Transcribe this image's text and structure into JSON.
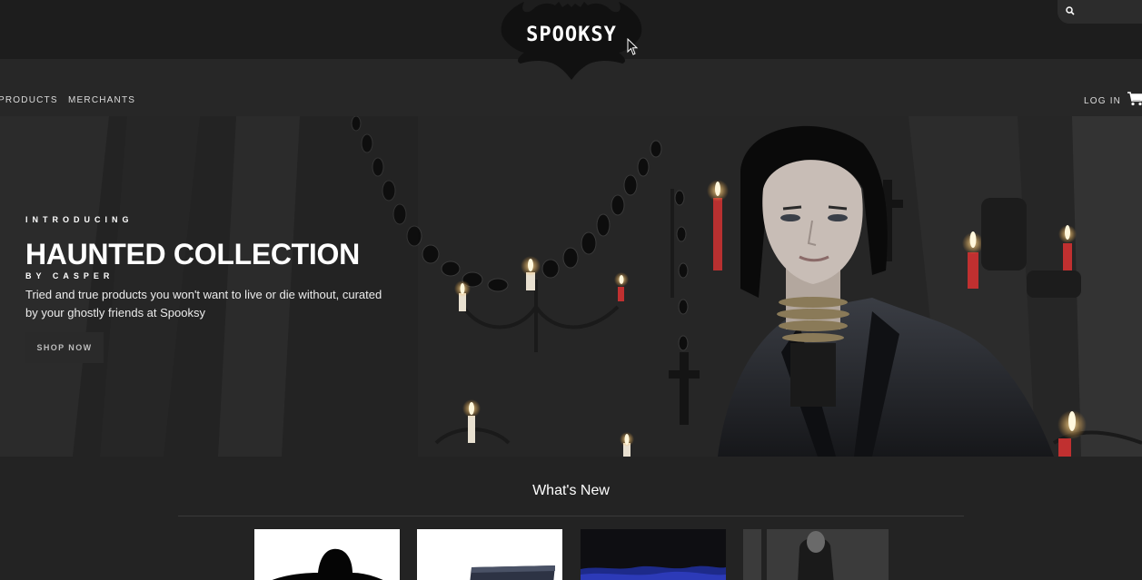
{
  "header": {
    "logo_text": "SPOOKSY",
    "search_icon": "search-icon"
  },
  "nav": {
    "products": "PRODUCTS",
    "merchants": "MERCHANTS",
    "login": "LOG IN",
    "cart_icon": "cart-icon"
  },
  "hero": {
    "eyebrow": "INTRODUCING",
    "headline": "HAUNTED COLLECTION",
    "byline": "BY CASPER",
    "description": "Tried and true products you won't want to live or die without, curated by your ghostly friends at Spooksy",
    "cta": "SHOP NOW"
  },
  "whats_new": {
    "title": "What's New",
    "products": [
      {
        "name": "product-1"
      },
      {
        "name": "product-2"
      },
      {
        "name": "product-3"
      },
      {
        "name": "product-4"
      }
    ]
  },
  "colors": {
    "background": "#232323",
    "topbar": "#1d1d1d",
    "nav": "#272727",
    "text": "#ffffff"
  }
}
